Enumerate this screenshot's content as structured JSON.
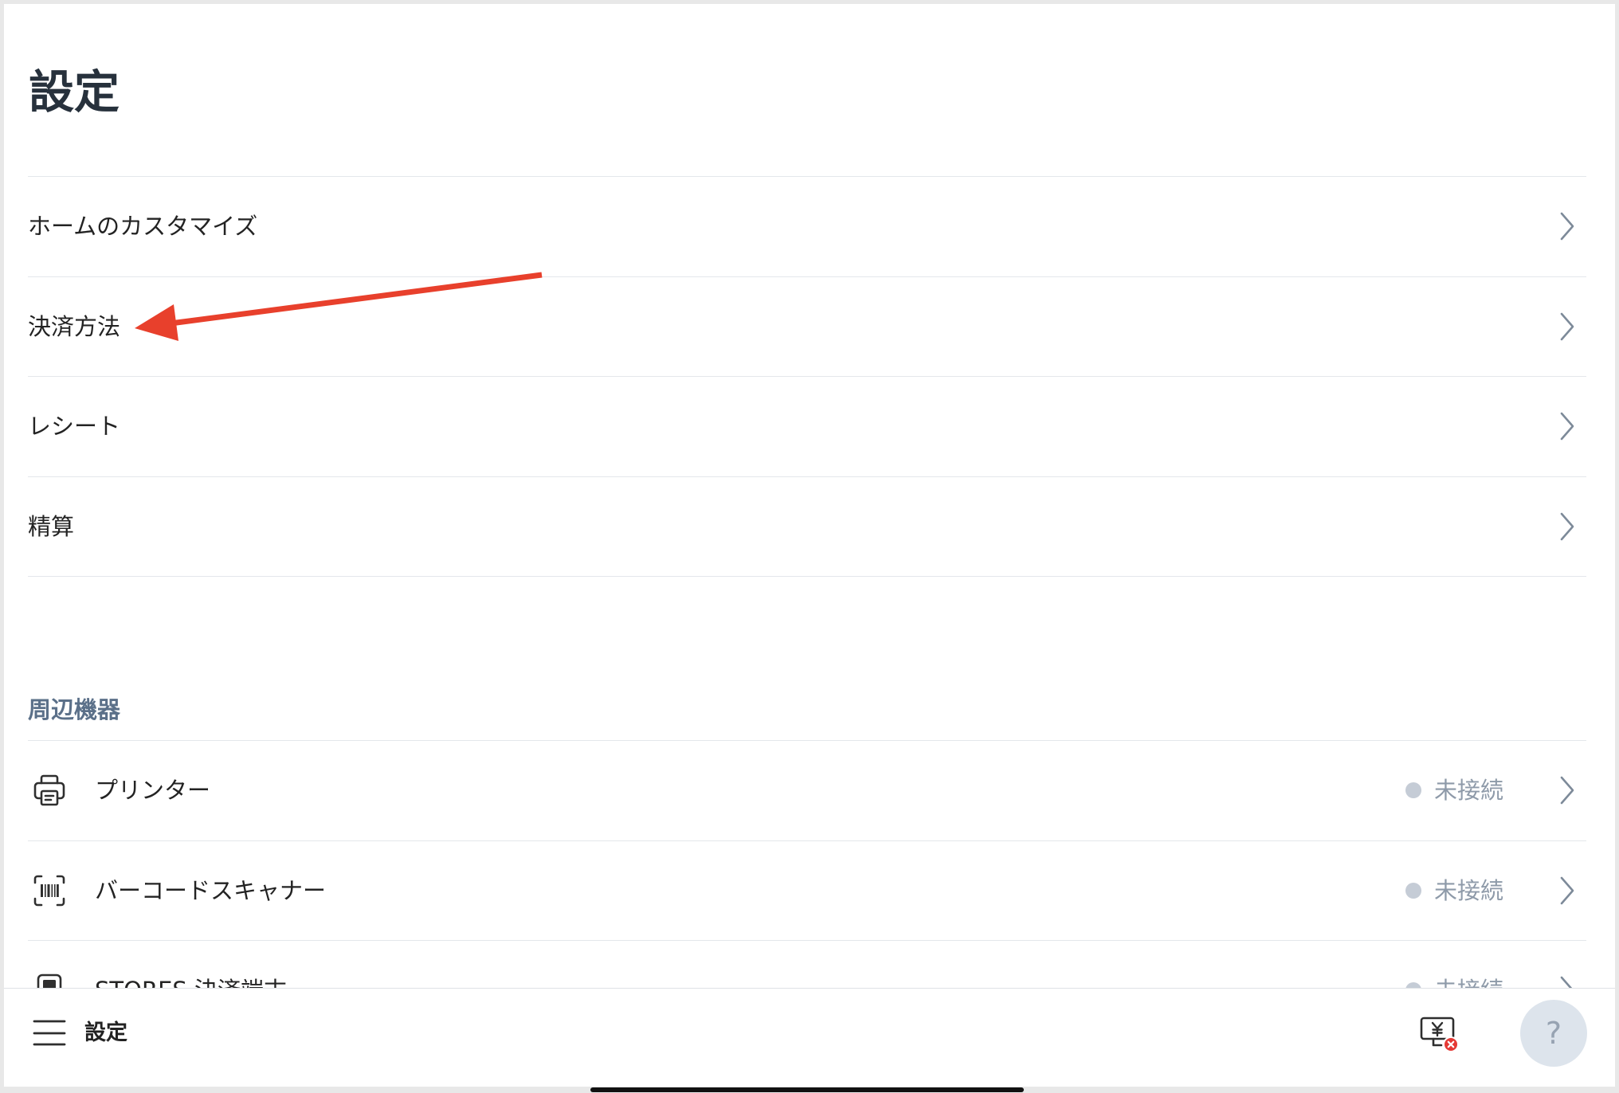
{
  "page": {
    "title": "設定"
  },
  "menu": {
    "items": [
      {
        "label": "ホームのカスタマイズ"
      },
      {
        "label": "決済方法"
      },
      {
        "label": "レシート"
      },
      {
        "label": "精算"
      }
    ],
    "chevron_icon": "chevron-right-icon"
  },
  "peripherals": {
    "heading": "周辺機器",
    "items": [
      {
        "label": "プリンター",
        "status": "未接続",
        "icon": "printer-icon"
      },
      {
        "label": "バーコードスキャナー",
        "status": "未接続",
        "icon": "barcode-scanner-icon"
      },
      {
        "label": "STORES 決済端末",
        "status": "未接続",
        "icon": "payment-terminal-icon"
      }
    ]
  },
  "bottom_bar": {
    "menu_icon": "hamburger-menu-icon",
    "title": "設定",
    "register_icon": "register-disconnected-icon",
    "help_label": "?"
  },
  "colors": {
    "text": "#232323",
    "title": "#27313c",
    "section_heading": "#5b7089",
    "divider": "#e4e7eb",
    "chevron": "#7d8a99",
    "status_dot": "#c5ccd6",
    "status_text": "#8e9aa9",
    "help_button": "#dde4ec",
    "error_badge": "#e53935",
    "annotation_arrow": "#e8402c"
  }
}
